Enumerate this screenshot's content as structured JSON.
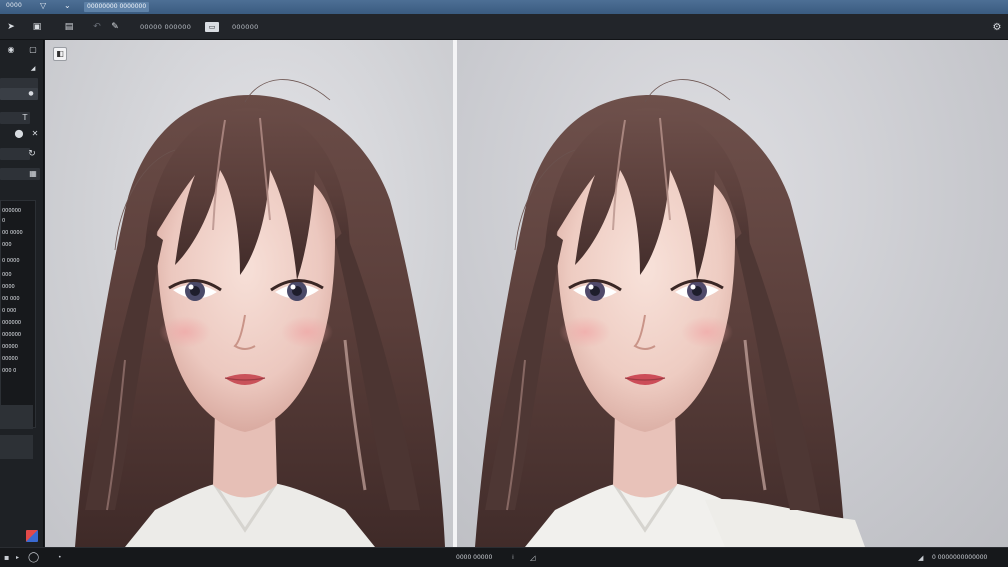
{
  "title_bar": {
    "left_text": "0000",
    "chip_text": "00000000 0000000"
  },
  "toolbar": {
    "label_1": "00000 000000",
    "label_2": "000000",
    "icons": [
      "pointer-icon",
      "save-icon",
      "layers-icon",
      "undo-icon",
      "brush-icon",
      "frame-icon"
    ]
  },
  "left_panel": {
    "list_items": [
      "000000",
      "0",
      "00 0000",
      "000",
      "0 0000",
      "000",
      "0000",
      "00 000",
      "0 000",
      "000000",
      "000000",
      "00000",
      "00000",
      "000 0"
    ]
  },
  "canvas": {
    "left_image": "anime-girl-portrait-original",
    "right_image": "anime-girl-portrait-edited"
  },
  "status_bar": {
    "center_text": "0000 00000",
    "right_text": "0 0000000000000"
  },
  "colors": {
    "titlebar": "#3f6187",
    "toolbar": "#22252a",
    "panel": "#1e2125",
    "canvas_bg": "#d2d2d6",
    "hair": "#5b423d",
    "skin": "#f0d5cd"
  }
}
